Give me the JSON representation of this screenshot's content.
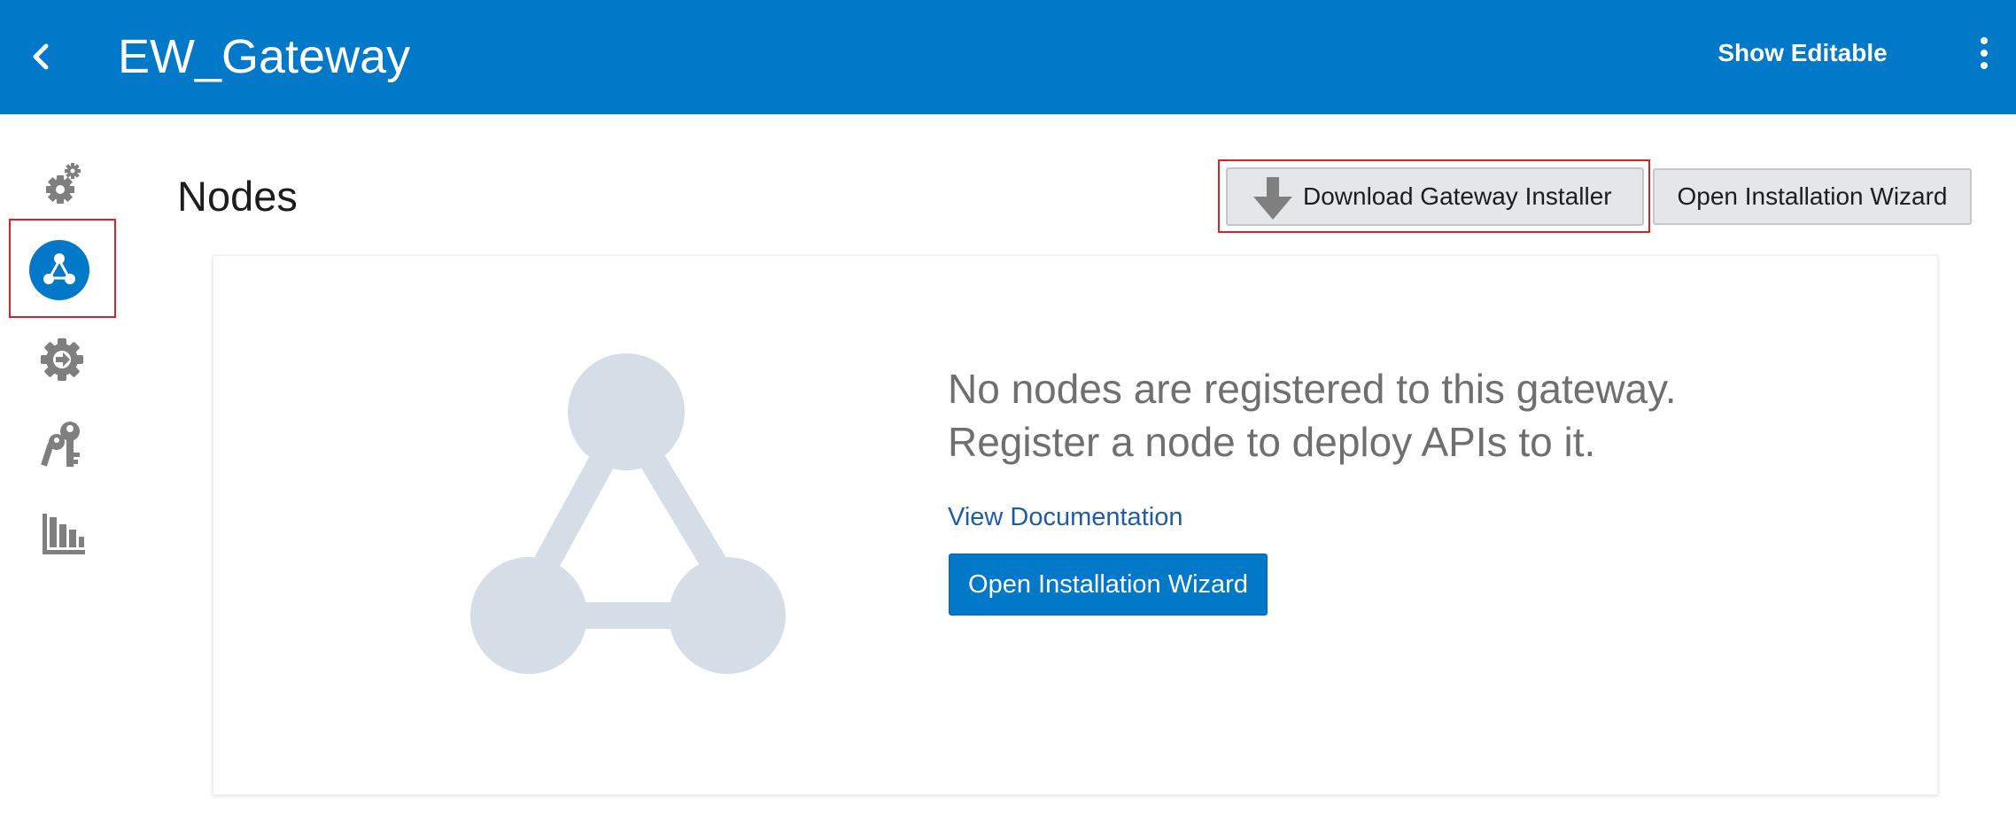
{
  "header": {
    "back_icon": "chevron-left-icon",
    "title": "EW_Gateway",
    "show_editable_label": "Show Editable",
    "more_icon": "kebab-menu-icon",
    "background_color": "#0179c8"
  },
  "sidebar": {
    "items": [
      {
        "icon": "settings-gears-icon",
        "selected": false
      },
      {
        "icon": "nodes-icon",
        "selected": true
      },
      {
        "icon": "deploy-gear-icon",
        "selected": false
      },
      {
        "icon": "keys-icon",
        "selected": false
      },
      {
        "icon": "analytics-bar-chart-icon",
        "selected": false
      }
    ],
    "selected_color": "#0179c8",
    "icon_color": "#7f7f7f"
  },
  "page": {
    "title": "Nodes",
    "download_installer_label": "Download Gateway Installer",
    "download_icon": "download-arrow-icon",
    "open_wizard_label": "Open Installation Wizard"
  },
  "empty_state": {
    "illustration_icon": "nodes-graph-icon",
    "message_line1": "No nodes are registered to this gateway.",
    "message_line2": "Register a node to deploy APIs to it.",
    "view_documentation_label": "View Documentation",
    "open_wizard_label": "Open Installation Wizard"
  },
  "annotations": {
    "highlight_color": "#e01f24"
  }
}
